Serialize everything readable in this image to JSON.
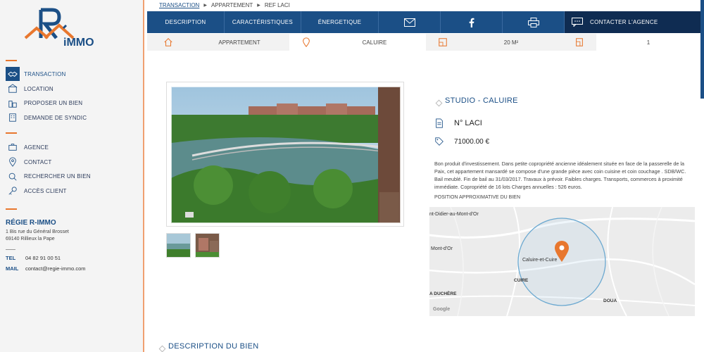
{
  "brand": {
    "logo_text": "iMMO",
    "accent": "#e8772e",
    "primary": "#1b4f86"
  },
  "sidebar": {
    "group1": [
      {
        "label": "TRANSACTION",
        "icon": "handshake-icon",
        "active": true
      },
      {
        "label": "LOCATION",
        "icon": "building-icon",
        "active": false
      },
      {
        "label": "PROPOSER UN BIEN",
        "icon": "city-icon",
        "active": false
      },
      {
        "label": "DEMANDE DE SYNDIC",
        "icon": "office-icon",
        "active": false
      }
    ],
    "group2": [
      {
        "label": "AGENCE",
        "icon": "briefcase-icon"
      },
      {
        "label": "CONTACT",
        "icon": "location-pin-icon"
      },
      {
        "label": "RECHERCHER UN BIEN",
        "icon": "search-icon"
      },
      {
        "label": "ACCÈS CLIENT",
        "icon": "key-icon"
      }
    ],
    "company": {
      "name": "RÉGIE R-IMMO",
      "address_line1": "1 Bis rue du Général Brosset",
      "address_line2": "69140 Rillieux la Pape",
      "tel_label": "TEL",
      "tel": "04 82 91 00 51",
      "mail_label": "MAIL",
      "mail": "contact@regie-immo.com"
    }
  },
  "breadcrumb": {
    "item1": "TRANSACTION",
    "item2": "APPARTEMENT",
    "item3": "REF LACI"
  },
  "topbar": {
    "description": "DESCRIPTION",
    "caracteristiques": "CARACTÉRISTIQUES",
    "energetique": "ÉNERGETIQUE",
    "contact": "CONTACTER L'AGENCE"
  },
  "strip": {
    "type": "APPARTEMENT",
    "city": "CALUIRE",
    "surface": "20 M²",
    "rooms": "1"
  },
  "listing": {
    "title": "STUDIO - CALUIRE",
    "ref": "N° LACI",
    "price": "71000.00 €",
    "description": "Bon produit d'investissement. Dans petite copropriété ancienne idéalement située en face de la passerelle de la Paix, cet appartement mansardé se compose d'une grande pièce avec coin cuisine et coin couchage . SDB/WC. Bail meublé. Fin de bail au 31/03/2017. Travaux à prévoir. Faibles charges. Transports, commerces à proximité immédiate. Copropriété de 16 lots Charges annuelles : 526 euros.",
    "map_label": "POSITION APPROXIMATIVE DU BIEN"
  },
  "map": {
    "labels": {
      "top_left": "nt-Didier-au-Mont-d'Or",
      "mid_left": "Mont-d'Or",
      "center": "Caluire-et-Cuire",
      "cuire": "CUIRE",
      "duchere": "A DUCHÈRE",
      "doua": "DOUA",
      "google": "Google"
    }
  },
  "section": {
    "description_title": "DESCRIPTION DU BIEN"
  }
}
